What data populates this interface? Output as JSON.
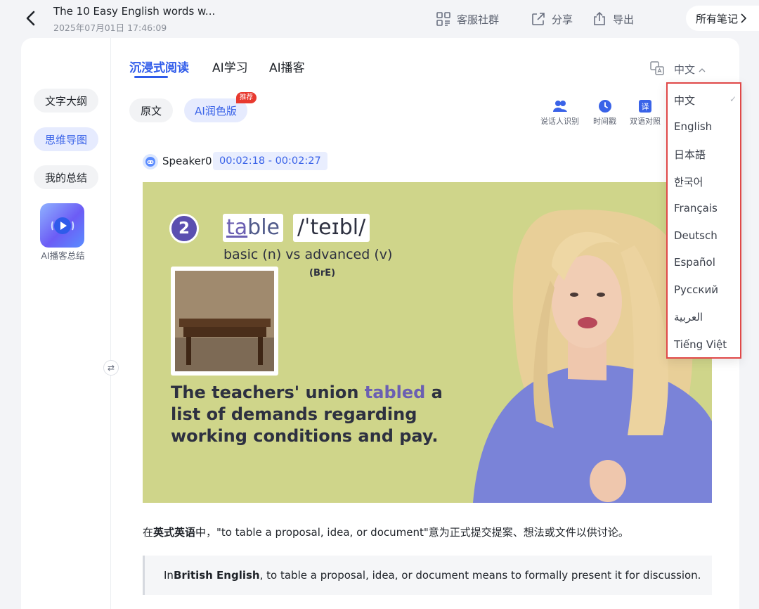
{
  "header": {
    "title": "The 10 Easy English words w...",
    "datetime": "2025年07月01日 17:46:09",
    "actions": {
      "service": "客服社群",
      "share": "分享",
      "export": "导出"
    },
    "all_notes": "所有笔记"
  },
  "left_nav": {
    "outline": "文字大纲",
    "mindmap": "思维导图",
    "summary": "我的总结",
    "podcast_label": "AI播客总结"
  },
  "tabs": [
    {
      "label": "沉浸式阅读",
      "active": true
    },
    {
      "label": "AI学习",
      "active": false
    },
    {
      "label": "AI播客",
      "active": false
    }
  ],
  "language": {
    "current": "中文",
    "options": [
      "中文",
      "English",
      "日本語",
      "한국어",
      "Français",
      "Deutsch",
      "Español",
      "Русский",
      "العربية",
      "Tiếng Việt"
    ],
    "selected_index": 0
  },
  "sub_tabs": {
    "original": "原文",
    "polished": "AI润色版",
    "badge": "推荐"
  },
  "tools": {
    "speaker_id": "说话人识别",
    "timestamp": "时间戳",
    "bilingual": "双语对照"
  },
  "segment": {
    "speaker": "Speaker0",
    "time_range": "00:02:18 - 00:02:27"
  },
  "frame": {
    "number": "2",
    "word_prefix": "ta",
    "word_suffix": "ble",
    "ipa": "/ˈteɪbl/",
    "basic_line": "basic (n)  vs  advanced (v)",
    "bre": "(BrE)",
    "sentence_before": "The teachers' union ",
    "sentence_highlight": "tabled",
    "sentence_after": " a list of demands regarding working conditions and pay."
  },
  "content": {
    "para_prefix": "在",
    "para_bold": "英式英语",
    "para_suffix": "中，\"to table a proposal, idea, or document\"意为正式提交提案、想法或文件以供讨论。",
    "quote_prefix": "In ",
    "quote_bold": "British English",
    "quote_suffix": ", to table a proposal, idea, or document means to formally present it for discussion."
  },
  "colors": {
    "accent": "#2f5bea",
    "highlight_border": "#e04848",
    "frame_bg": "#cfd58a"
  }
}
